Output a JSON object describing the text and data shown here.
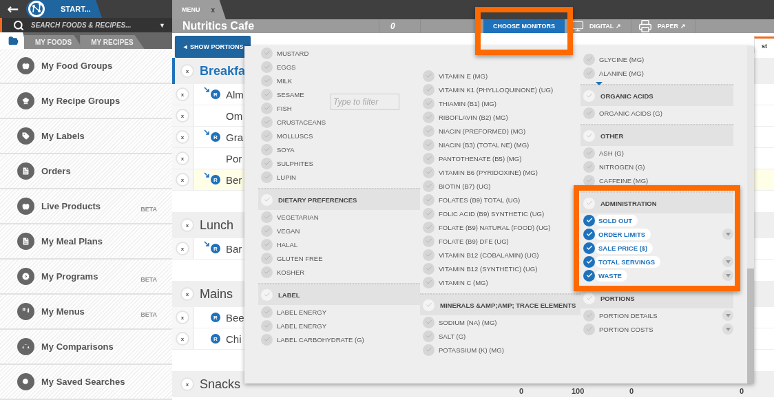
{
  "sidebar": {
    "back_label": "←",
    "start_tab": "START...",
    "search": {
      "placeholder": "SEARCH FOODS & RECIPES...",
      "caret": "▼"
    },
    "tabs": [
      {
        "kind": "folder",
        "selected": true
      },
      {
        "kind": "text",
        "label": "MY FOODS",
        "selected": false
      },
      {
        "kind": "text",
        "label": "MY RECIPES",
        "selected": false
      }
    ],
    "items": [
      {
        "label": "My Food Groups"
      },
      {
        "label": "My Recipe Groups"
      },
      {
        "label": "My Labels"
      },
      {
        "label": "Orders"
      },
      {
        "label": "Live Products",
        "badge": "BETA"
      },
      {
        "label": "My Meal Plans"
      },
      {
        "label": "My Programs",
        "badge": "BETA"
      },
      {
        "label": "My Menus",
        "badge": "BETA"
      },
      {
        "label": "My Comparisons"
      },
      {
        "label": "My Saved Searches"
      }
    ]
  },
  "main": {
    "tab": {
      "label": "MENU",
      "close": "x"
    },
    "header": {
      "title": "Nutritics Cafe",
      "count": "0",
      "buttons": [
        {
          "kind": "primary",
          "label": "CHOOSE MONITORS"
        },
        {
          "kind": "digital",
          "label": "DIGITAL ↗"
        },
        {
          "kind": "paper",
          "label": "PAPER ↗"
        }
      ]
    },
    "show_portions": "◄ SHOW PORTIONS",
    "column_fragment": "st",
    "sections": [
      {
        "title": "Breakfa",
        "remove": "x",
        "selected": true,
        "rows": [
          {
            "name": "Alm",
            "remove": "x",
            "badge": "R",
            "linked": true,
            "selected": false
          },
          {
            "name": "Om",
            "remove": "x",
            "linked": false,
            "selected": false
          },
          {
            "name": "Gra",
            "remove": "x",
            "badge": "R",
            "linked": true,
            "selected": false
          },
          {
            "name": "Por",
            "remove": "x",
            "linked": false,
            "selected": false
          },
          {
            "name": "Ber",
            "remove": "x",
            "badge": "R",
            "linked": true,
            "selected": true
          }
        ]
      },
      {
        "title": "Lunch",
        "remove": "x",
        "selected": false,
        "rows": [
          {
            "name": "Bar",
            "remove": "x",
            "badge": "R",
            "linked": true,
            "selected": false
          }
        ]
      },
      {
        "title": "Mains",
        "remove": "x",
        "selected": false,
        "rows": [
          {
            "name": "Bee",
            "remove": "x",
            "badge": "R",
            "linked": false,
            "selected": false
          },
          {
            "name": "Chi",
            "remove": "x",
            "badge": "R",
            "linked": false,
            "selected": false
          }
        ]
      },
      {
        "title": "Snacks",
        "remove": "x",
        "selected": false,
        "values": [
          "0",
          "100",
          "0",
          "0"
        ]
      }
    ]
  },
  "panel": {
    "filter": {
      "placeholder": "Type to filter"
    },
    "columns": [
      {
        "entries": [
          {
            "kind": "item",
            "label": "MUSTARD",
            "checked": false
          },
          {
            "kind": "item",
            "label": "EGGS",
            "checked": false
          },
          {
            "kind": "item",
            "label": "MILK",
            "checked": false
          },
          {
            "kind": "item",
            "label": "SESAME",
            "checked": false
          },
          {
            "kind": "item",
            "label": "FISH",
            "checked": false
          },
          {
            "kind": "item",
            "label": "CRUSTACEANS",
            "checked": false
          },
          {
            "kind": "item",
            "label": "MOLLUSCS",
            "checked": false
          },
          {
            "kind": "item",
            "label": "SOYA",
            "checked": false
          },
          {
            "kind": "item",
            "label": "SULPHITES",
            "checked": false
          },
          {
            "kind": "item",
            "label": "LUPIN",
            "checked": false
          },
          {
            "kind": "group",
            "label": "DIETARY PREFERENCES",
            "checked": false
          },
          {
            "kind": "item",
            "label": "VEGETARIAN",
            "checked": false
          },
          {
            "kind": "item",
            "label": "VEGAN",
            "checked": false
          },
          {
            "kind": "item",
            "label": "HALAL",
            "checked": false
          },
          {
            "kind": "item",
            "label": "GLUTEN FREE",
            "checked": false
          },
          {
            "kind": "item",
            "label": "KOSHER",
            "checked": false
          },
          {
            "kind": "group",
            "label": "LABEL",
            "checked": false
          },
          {
            "kind": "item",
            "label": "LABEL ENERGY",
            "checked": false
          },
          {
            "kind": "item",
            "label": "LABEL ENERGY",
            "checked": false
          },
          {
            "kind": "item",
            "label": "LABEL CARBOHYDRATE (G)",
            "checked": false
          }
        ]
      },
      {
        "entries": [
          {
            "kind": "item",
            "label": "VITAMIN E (MG)",
            "checked": false
          },
          {
            "kind": "item",
            "label": "VITAMIN K1 (PHYLLOQUINONE) (UG)",
            "checked": false
          },
          {
            "kind": "item",
            "label": "THIAMIN (B1) (MG)",
            "checked": false
          },
          {
            "kind": "item",
            "label": "RIBOFLAVIN (B2) (MG)",
            "checked": false
          },
          {
            "kind": "item",
            "label": "NIACIN (PREFORMED) (MG)",
            "checked": false
          },
          {
            "kind": "item",
            "label": "NIACIN (B3) (TOTAL NE) (MG)",
            "checked": false
          },
          {
            "kind": "item",
            "label": "PANTOTHENATE (B5) (MG)",
            "checked": false
          },
          {
            "kind": "item",
            "label": "VITAMIN B6 (PYRIDOXINE) (MG)",
            "checked": false
          },
          {
            "kind": "item",
            "label": "BIOTIN (B7) (UG)",
            "checked": false
          },
          {
            "kind": "item",
            "label": "FOLATES (B9) TOTAL (UG)",
            "checked": false
          },
          {
            "kind": "item",
            "label": "FOLIC ACID (B9) SYNTHETIC (UG)",
            "checked": false
          },
          {
            "kind": "item",
            "label": "FOLATE (B9) NATURAL (FOOD) (UG)",
            "checked": false
          },
          {
            "kind": "item",
            "label": "FOLATE (B9) DFE (UG)",
            "checked": false
          },
          {
            "kind": "item",
            "label": "VITAMIN B12 (COBALAMIN) (UG)",
            "checked": false
          },
          {
            "kind": "item",
            "label": "VITAMIN B12 (SYNTHETIC) (UG)",
            "checked": false
          },
          {
            "kind": "item",
            "label": "VITAMIN C (MG)",
            "checked": false
          },
          {
            "kind": "group",
            "label": "MINERALS &AMP;AMP; TRACE ELEMENTS",
            "checked": false
          },
          {
            "kind": "item",
            "label": "SODIUM (NA) (MG)",
            "checked": false
          },
          {
            "kind": "item",
            "label": "SALT (G)",
            "checked": false
          },
          {
            "kind": "item",
            "label": "POTASSIUM (K) (MG)",
            "checked": false
          }
        ]
      },
      {
        "entries": [
          {
            "kind": "item",
            "label": "GLYCINE (MG)",
            "checked": false
          },
          {
            "kind": "item",
            "label": "ALANINE (MG)",
            "checked": false
          },
          {
            "kind": "group",
            "label": "ORGANIC ACIDS",
            "checked": false
          },
          {
            "kind": "item",
            "label": "ORGANIC ACIDS (G)",
            "checked": false
          },
          {
            "kind": "group",
            "label": "OTHER",
            "checked": false
          },
          {
            "kind": "item",
            "label": "ASH (G)",
            "checked": false
          },
          {
            "kind": "item",
            "label": "NITROGEN (G)",
            "checked": false
          },
          {
            "kind": "item",
            "label": "CAFFEINE (MG)",
            "checked": false
          },
          {
            "kind": "group",
            "label": "ADMINISTRATION",
            "checked": false
          },
          {
            "kind": "item",
            "label": "SOLD OUT",
            "checked": true
          },
          {
            "kind": "item",
            "label": "ORDER LIMITS",
            "checked": true,
            "has_options": true
          },
          {
            "kind": "item",
            "label": "SALE PRICE ($)",
            "checked": true
          },
          {
            "kind": "item",
            "label": "TOTAL SERVINGS",
            "checked": true,
            "has_options": true
          },
          {
            "kind": "item",
            "label": "WASTE",
            "checked": true,
            "has_options": true
          },
          {
            "kind": "group",
            "label": "PORTIONS",
            "checked": false
          },
          {
            "kind": "item",
            "label": "PORTION DETAILS",
            "checked": false,
            "has_options": true
          },
          {
            "kind": "item",
            "label": "PORTION COSTS",
            "checked": false,
            "has_options": true
          }
        ]
      }
    ]
  }
}
